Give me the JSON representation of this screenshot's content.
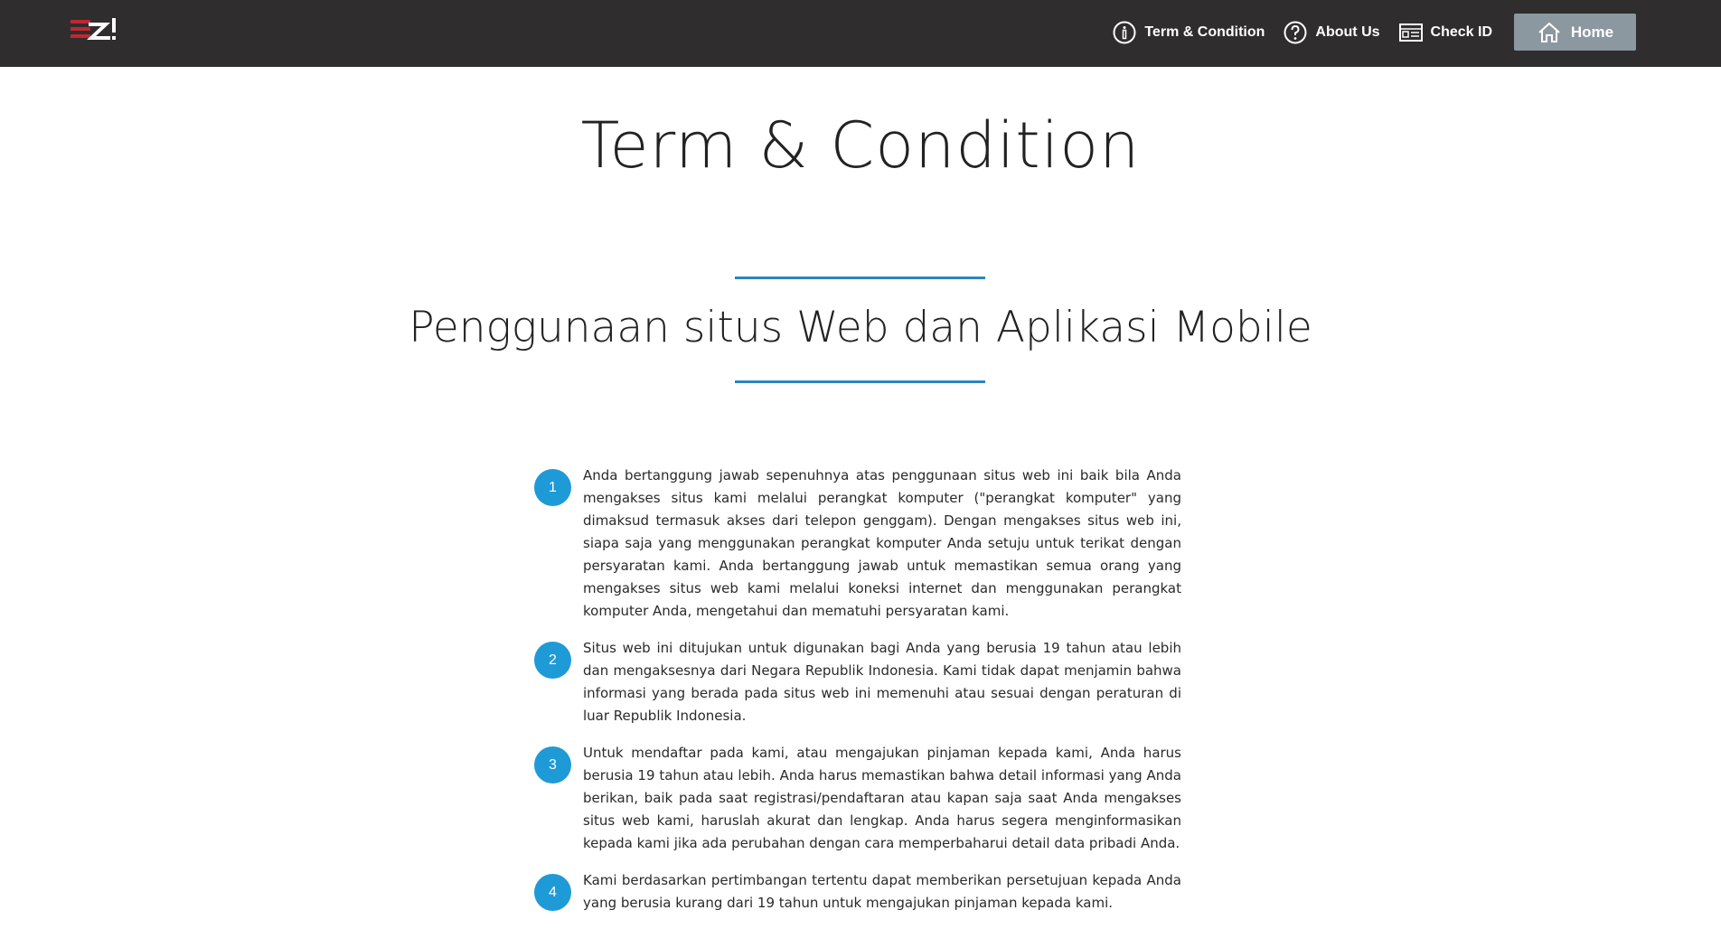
{
  "navbar": {
    "logo_text": "Z!",
    "links": [
      {
        "label": "Term & Condition",
        "icon": "info-circle-icon"
      },
      {
        "label": "About Us",
        "icon": "question-circle-icon"
      },
      {
        "label": "Check ID",
        "icon": "id-card-icon"
      }
    ],
    "home_label": "Home",
    "home_icon": "home-icon"
  },
  "page": {
    "title": "Term & Condition",
    "section_title": "Penggunaan situs Web dan Aplikasi Mobile"
  },
  "terms": [
    {
      "number": "1",
      "text": "Anda bertanggung jawab sepenuhnya atas penggunaan situs web ini baik bila Anda mengakses situs kami melalui perangkat komputer (\"perangkat komputer\" yang dimaksud termasuk akses dari telepon genggam). Dengan mengakses situs web ini, siapa saja yang menggunakan perangkat komputer Anda setuju untuk terikat dengan persyaratan kami. Anda bertanggung jawab untuk memastikan semua orang yang mengakses situs web kami melalui koneksi internet dan menggunakan perangkat komputer Anda, mengetahui dan mematuhi persyaratan kami."
    },
    {
      "number": "2",
      "text": "Situs web ini ditujukan untuk digunakan bagi Anda yang berusia 19 tahun atau lebih dan mengaksesnya dari Negara Republik Indonesia. Kami tidak dapat menjamin bahwa informasi yang berada pada situs web ini memenuhi atau sesuai dengan peraturan di luar Republik Indonesia."
    },
    {
      "number": "3",
      "text": "Untuk mendaftar pada kami, atau mengajukan pinjaman kepada kami, Anda harus berusia 19 tahun atau lebih. Anda harus memastikan bahwa detail informasi yang Anda berikan, baik pada saat registrasi/pendaftaran atau kapan saja saat Anda mengakses situs web kami, haruslah akurat dan lengkap. Anda harus segera menginformasikan kepada kami jika ada perubahan dengan cara memperbaharui detail data pribadi Anda."
    },
    {
      "number": "4",
      "text": "Kami berdasarkan pertimbangan tertentu dapat memberikan persetujuan kepada Anda yang berusia kurang dari 19 tahun untuk mengajukan pinjaman kepada kami."
    }
  ],
  "colors": {
    "navbar_bg": "#2f2d2e",
    "accent_blue": "#1e9ad6",
    "rule_blue": "#2a86bf",
    "home_btn_bg": "#8c98a0",
    "logo_red": "#c0282e"
  }
}
